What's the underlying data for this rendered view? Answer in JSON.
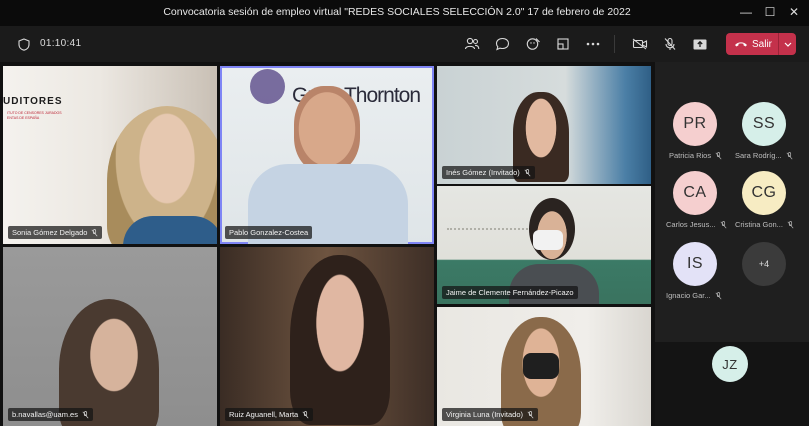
{
  "window": {
    "title": "Convocatoria sesión de empleo virtual \"REDES SOCIALES SELECCIÓN 2.0\" 17 de febrero de 2022",
    "minimize_label": "—",
    "maximize_label": "☐",
    "close_label": "✕"
  },
  "toolbar": {
    "timer": "01:10:41",
    "leave_label": "Salir"
  },
  "video_tiles": [
    {
      "name": "Sonia Gómez Delgado",
      "sign_text": "UDITORES",
      "sign_small": [
        "ITUTO DE CENSORES JURADOS",
        "ENTAS DE ESPAÑA"
      ]
    },
    {
      "name": "Pablo Gonzalez-Costea",
      "sign_text": "Grant Thornton"
    },
    {
      "name": "Inés Gómez (Invitado)"
    },
    {
      "name": "Jaime de Clemente Fernández-Picazo"
    },
    {
      "name": "b.navallas@uam.es"
    },
    {
      "name": "Ruiz Aguanell, Marta"
    },
    {
      "name": "Virginia Luna (Invitado)"
    }
  ],
  "roster": [
    {
      "initials": "PR",
      "name": "Patricia Rios",
      "color": "#f5cfcf"
    },
    {
      "initials": "SS",
      "name": "Sara Rodríg...",
      "color": "#d6efe9"
    },
    {
      "initials": "CA",
      "name": "Carlos Jesus...",
      "color": "#f5cfcf"
    },
    {
      "initials": "CG",
      "name": "Cristina Gon...",
      "color": "#f7ecc3"
    },
    {
      "initials": "IS",
      "name": "Ignacio Gar...",
      "color": "#e3e2f7"
    }
  ],
  "overflow_count": "+4",
  "self_view": {
    "initials": "JZ",
    "color": "#d6efe9"
  },
  "colors": {
    "accent_leave": "#c4314b",
    "panel": "#1f1f1f",
    "toolbar": "#1b1b1b"
  }
}
